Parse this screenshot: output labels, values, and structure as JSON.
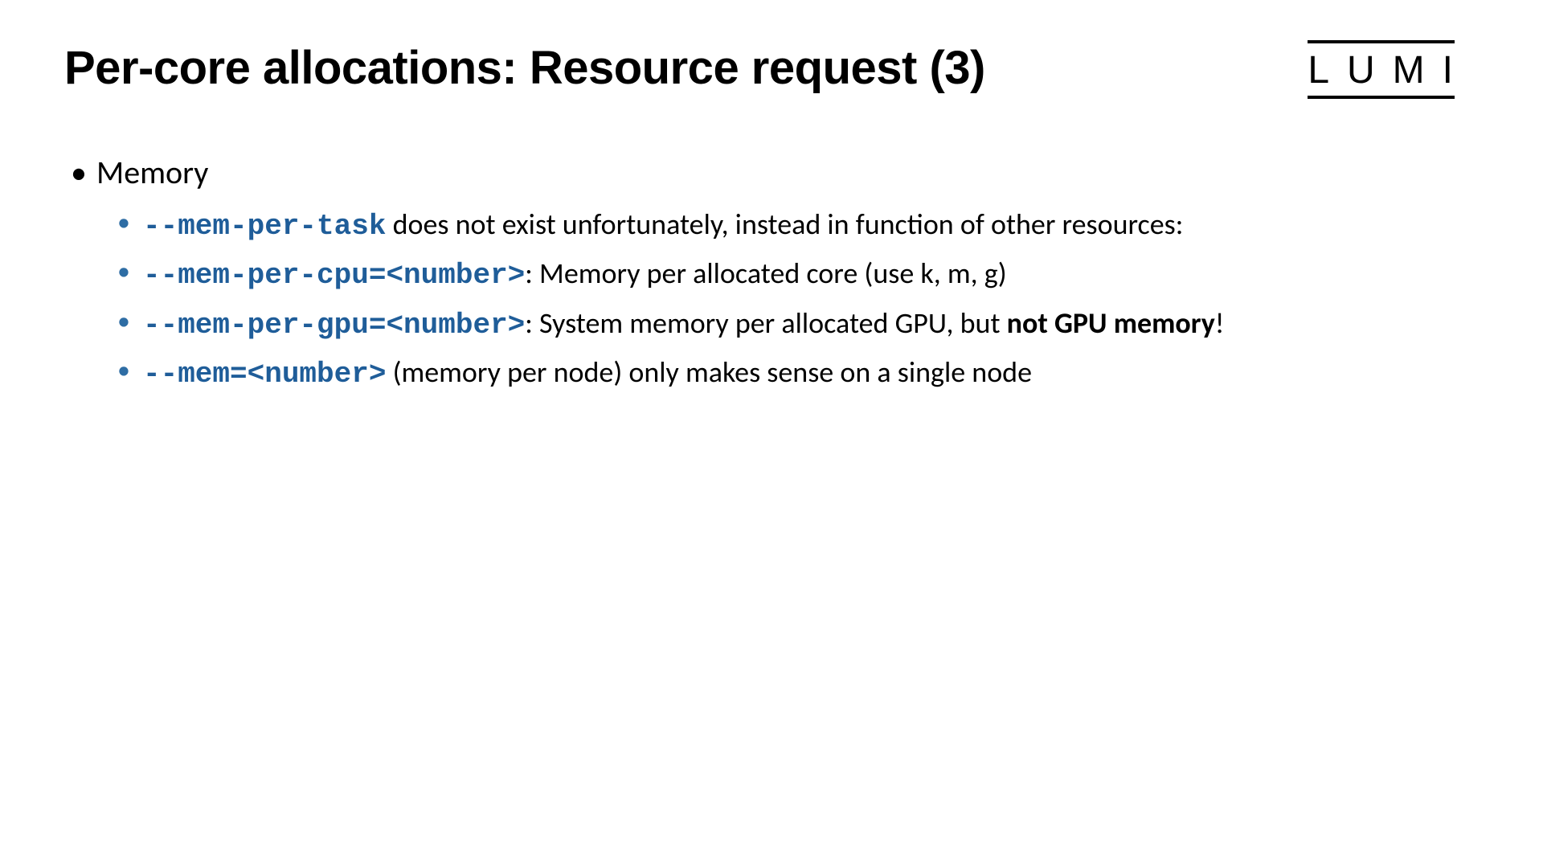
{
  "logo": "LUMI",
  "title": "Per-core allocations: Resource request (3)",
  "topicLabel": "Memory",
  "bullets": [
    {
      "code": "--mem-per-task",
      "text_after": " does not exist unfortunately, instead in function of other resources:"
    },
    {
      "code": "--mem-per-cpu=<number>",
      "text_after": ": Memory per allocated core (use k, m, g)"
    },
    {
      "code": "--mem-per-gpu=<number>",
      "text_after": ": System memory per allocated GPU, but ",
      "bold": "not GPU memory",
      "tail": "!"
    },
    {
      "code": "--mem=<number>",
      "text_after": " (memory per node) only makes sense on a single node"
    }
  ]
}
